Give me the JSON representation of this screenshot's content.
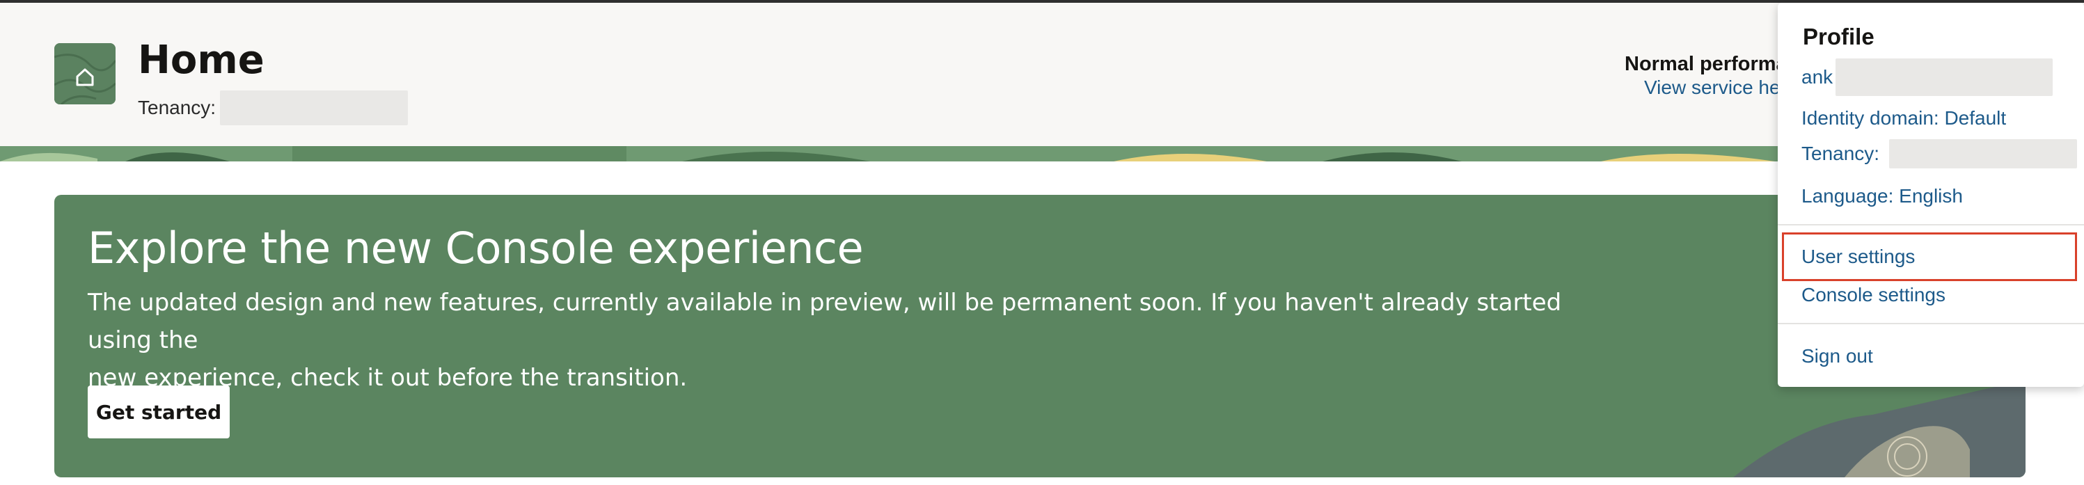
{
  "header": {
    "title": "Home",
    "tenancy_label": "Tenancy:",
    "status_title": "Normal performa",
    "status_link": "View service he"
  },
  "banner": {
    "title": "Explore the new Console experience",
    "text_line1": "The updated design and new features, currently available in preview, will be permanent soon. If you haven't already started using the",
    "text_line2": "new experience, check it out before the transition.",
    "button_label": "Get started",
    "background_color": "#5b8560"
  },
  "profile_menu": {
    "title": "Profile",
    "user_prefix": "ank",
    "identity_domain": "Identity domain: Default",
    "tenancy_label": "Tenancy:",
    "language": "Language: English",
    "user_settings": "User settings",
    "console_settings": "Console settings",
    "sign_out": "Sign out",
    "highlight_color": "#d9412b",
    "link_color": "#1d5a8a"
  },
  "icons": {
    "home": "home-icon"
  }
}
